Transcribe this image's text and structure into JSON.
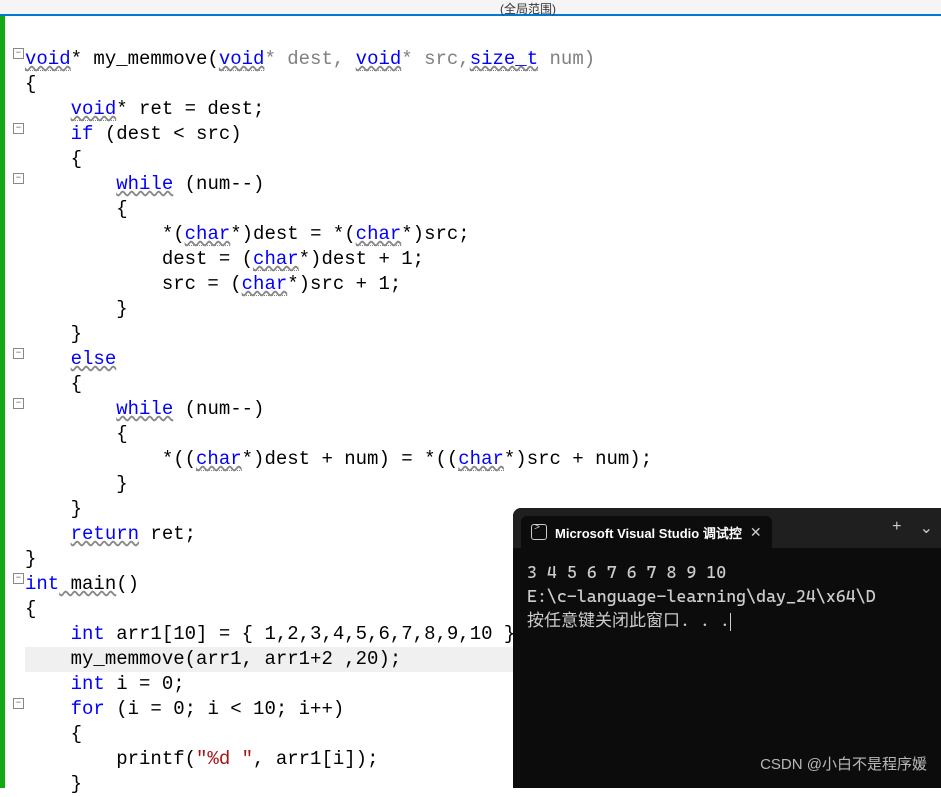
{
  "top_label": "(全局范围)",
  "code": {
    "l1_void": "void",
    "l1_func": " my_memmove(",
    "l1_void2": "void",
    "l1_dest": "* dest, ",
    "l1_void3": "void",
    "l1_src": "* src,",
    "l1_sizet": "size_t",
    "l1_num": " num)",
    "l2": "{",
    "l3a": "    ",
    "l3_void": "void",
    "l3b": "* ret = dest;",
    "l4a": "    ",
    "l4_if": "if",
    "l4b": " (dest < src)",
    "l5": "    {",
    "l6a": "        ",
    "l6_while": "while",
    "l6b": " (num--)",
    "l7": "        {",
    "l8a": "            *(",
    "l8_char": "char",
    "l8b": "*)dest = *(",
    "l8_char2": "char",
    "l8c": "*)src;",
    "l9a": "            dest = (",
    "l9_char": "char",
    "l9b": "*)dest + 1;",
    "l10a": "            src = (",
    "l10_char": "char",
    "l10b": "*)src + 1;",
    "l11": "        }",
    "l12": "    }",
    "l13a": "    ",
    "l13_else": "else",
    "l14": "    {",
    "l15a": "        ",
    "l15_while": "while",
    "l15b": " (num--)",
    "l16": "        {",
    "l17a": "            *((",
    "l17_char": "char",
    "l17b": "*)dest + num) = *((",
    "l17_char2": "char",
    "l17c": "*)src + num);",
    "l18": "        }",
    "l19": "    }",
    "l20a": "    ",
    "l20_return": "return",
    "l20b": " ret;",
    "l21": "}",
    "l22_int": "int",
    "l22_main": " main",
    "l22b": "()",
    "l23": "{",
    "l24a": "    ",
    "l24_int": "int",
    "l24b": " arr1[10] = { 1,2,3,4,5,6,7,8,9,10 };",
    "l25a": "    my_memmove(arr1, arr1+2 ,20);",
    "l26a": "    ",
    "l26_int": "int",
    "l26b": " i = 0;",
    "l27a": "    ",
    "l27_for": "for",
    "l27b": " (i = 0; i < 10; i++)",
    "l28": "    {",
    "l29a": "        printf(",
    "l29_str": "\"%d \"",
    "l29b": ", arr1[i]);",
    "l30": "    }"
  },
  "terminal": {
    "title": "Microsoft Visual Studio 调试控",
    "output_line1": "3 4 5 6 7 6 7 8 9 10",
    "output_line2": "E:\\c-language-learning\\day_24\\x64\\D",
    "output_line3": "按任意键关闭此窗口. . ."
  },
  "watermark": "CSDN @小白不是程序媛",
  "folds": [
    48,
    123,
    173,
    348,
    398,
    573,
    698
  ]
}
